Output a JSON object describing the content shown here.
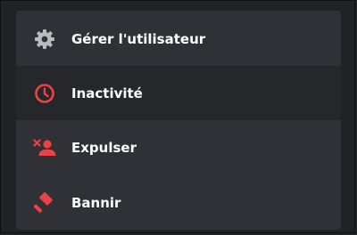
{
  "menu": {
    "items": [
      {
        "label": "Gérer l'utilisateur",
        "icon": "gear-icon"
      },
      {
        "label": "Inactivité",
        "icon": "clock-icon"
      },
      {
        "label": "Expulser",
        "icon": "remove-user-icon"
      },
      {
        "label": "Bannir",
        "icon": "ban-hammer-icon"
      }
    ]
  },
  "colors": {
    "background": "#212226",
    "menu": "#2f3136",
    "hover": "#25272b",
    "text": "#ffffff",
    "neutral_icon": "#b9bbbe",
    "danger": "#ed4245"
  }
}
